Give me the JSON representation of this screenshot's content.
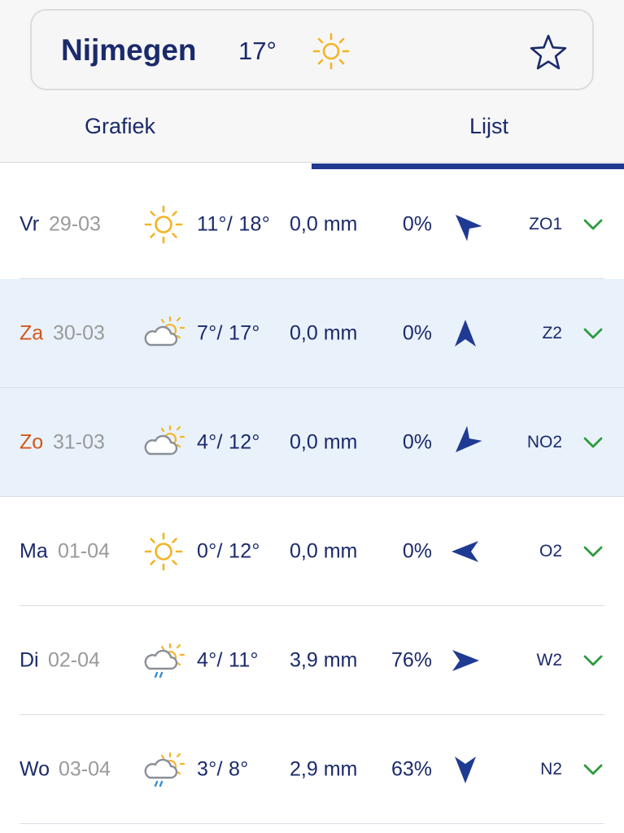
{
  "header": {
    "city": "Nijmegen",
    "current_temp": "17°",
    "current_icon": "sun-icon",
    "favorite_icon": "star-icon"
  },
  "tabs": [
    {
      "label": "Grafiek",
      "active": false
    },
    {
      "label": "Lijst",
      "active": true
    }
  ],
  "colors": {
    "primary": "#1b2a6b",
    "accent_bar": "#1f3a93",
    "weekend": "#d4561b",
    "highlight_row": "#e9f2fb",
    "sun": "#f5b325",
    "chevron": "#2e9b3e"
  },
  "forecast": [
    {
      "day": "Vr",
      "date": "29-03",
      "weekend": false,
      "highlight": false,
      "icon": "sun-icon",
      "temps": "11°/ 18°",
      "precip": "0,0 mm",
      "chance": "0%",
      "wind_dir_deg": 315,
      "wind": "ZO1"
    },
    {
      "day": "Za",
      "date": "30-03",
      "weekend": true,
      "highlight": true,
      "icon": "partly-cloudy-icon",
      "temps": "7°/ 17°",
      "precip": "0,0 mm",
      "chance": "0%",
      "wind_dir_deg": 0,
      "wind": "Z2"
    },
    {
      "day": "Zo",
      "date": "31-03",
      "weekend": true,
      "highlight": true,
      "icon": "partly-cloudy-icon",
      "temps": "4°/ 12°",
      "precip": "0,0 mm",
      "chance": "0%",
      "wind_dir_deg": 225,
      "wind": "NO2"
    },
    {
      "day": "Ma",
      "date": "01-04",
      "weekend": false,
      "highlight": false,
      "icon": "sun-icon",
      "temps": "0°/ 12°",
      "precip": "0,0 mm",
      "chance": "0%",
      "wind_dir_deg": 270,
      "wind": "O2"
    },
    {
      "day": "Di",
      "date": "02-04",
      "weekend": false,
      "highlight": false,
      "icon": "partly-cloudy-rain-icon",
      "temps": "4°/ 11°",
      "precip": "3,9 mm",
      "chance": "76%",
      "wind_dir_deg": 90,
      "wind": "W2"
    },
    {
      "day": "Wo",
      "date": "03-04",
      "weekend": false,
      "highlight": false,
      "icon": "partly-cloudy-rain-icon",
      "temps": "3°/ 8°",
      "precip": "2,9 mm",
      "chance": "63%",
      "wind_dir_deg": 180,
      "wind": "N2"
    }
  ]
}
